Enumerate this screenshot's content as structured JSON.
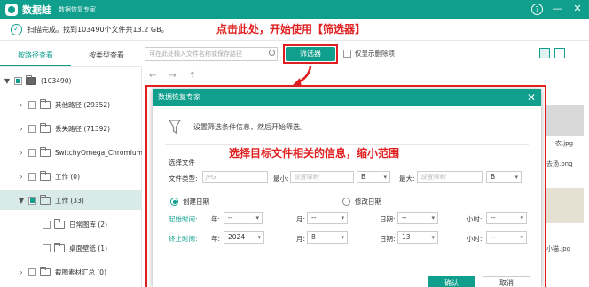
{
  "app": {
    "name": "数据蛙",
    "subtitle": "数据恢复专家",
    "help_label": "?",
    "minimize_label": "—",
    "close_label": "✕"
  },
  "status": {
    "text": "扫描完成。找到103490个文件共13.2 GB。"
  },
  "annotations": {
    "top": "点击此处，开始使用【筛选器】",
    "middle": "选择目标文件相关的信息，缩小范围"
  },
  "left_tabs": [
    {
      "label": "按路径查看",
      "active": true
    },
    {
      "label": "按类型查看",
      "active": false
    }
  ],
  "tree": [
    {
      "chev": "▼",
      "label": "(103490)",
      "selected": false,
      "partial": true,
      "indent": 0,
      "type": "drive"
    },
    {
      "chev": "›",
      "label": "其他路径 (29352)",
      "selected": false,
      "partial": false,
      "indent": 1,
      "type": "folder"
    },
    {
      "chev": "›",
      "label": "丢失路径 (71392)",
      "selected": false,
      "partial": false,
      "indent": 1,
      "type": "folder"
    },
    {
      "chev": "›",
      "label": "SwitchyOmega_Chromium",
      "selected": false,
      "partial": false,
      "indent": 1,
      "type": "folder"
    },
    {
      "chev": "›",
      "label": "工作 (0)",
      "selected": false,
      "partial": false,
      "indent": 1,
      "type": "folder"
    },
    {
      "chev": "▼",
      "label": "工作 (33)",
      "selected": true,
      "partial": true,
      "indent": 1,
      "type": "folder"
    },
    {
      "chev": "",
      "label": "日常图库 (2)",
      "selected": false,
      "partial": false,
      "indent": 2,
      "type": "folder"
    },
    {
      "chev": "",
      "label": "桌面壁纸 (1)",
      "selected": false,
      "partial": false,
      "indent": 2,
      "type": "folder"
    },
    {
      "chev": "›",
      "label": "截图素材汇总 (0)",
      "selected": false,
      "partial": false,
      "indent": 1,
      "type": "folder"
    }
  ],
  "toolbar": {
    "search_placeholder": "可在此处输入文件名称或保存路径",
    "filter_label": "筛选器",
    "deleted_only_label": "仅显示删除项",
    "back_label": "←",
    "forward_label": "→",
    "up_label": "↑"
  },
  "background_captions": [
    "农.jpg",
    "去汤.png",
    "小猫.jpg"
  ],
  "dialog": {
    "title": "数据恢复专家",
    "close_label": "✕",
    "intro": "设置筛选条件信息，然后开始筛选。",
    "section_file": "选择文件",
    "file_type_label": "文件类型:",
    "file_type_placeholder": "JPG",
    "min_label": "最小:",
    "min_placeholder": "设置限制",
    "min_unit": "B",
    "max_label": "最大:",
    "max_placeholder": "设置限制",
    "max_unit": "B",
    "radio_created": "创建日期",
    "radio_modified": "修改日期",
    "start_label": "起始时间:",
    "end_label": "终止时间:",
    "year_label": "年:",
    "month_label": "月:",
    "day_label": "日期:",
    "hour_label": "小时:",
    "start": {
      "year": "--",
      "month": "--",
      "day": "--",
      "hour": "--"
    },
    "end": {
      "year": "2024",
      "month": "8",
      "day": "13",
      "hour": "--"
    },
    "ok_label": "确认",
    "cancel_label": "取消"
  },
  "colors": {
    "accent": "#0f9f8c",
    "annotation": "#e02020"
  }
}
